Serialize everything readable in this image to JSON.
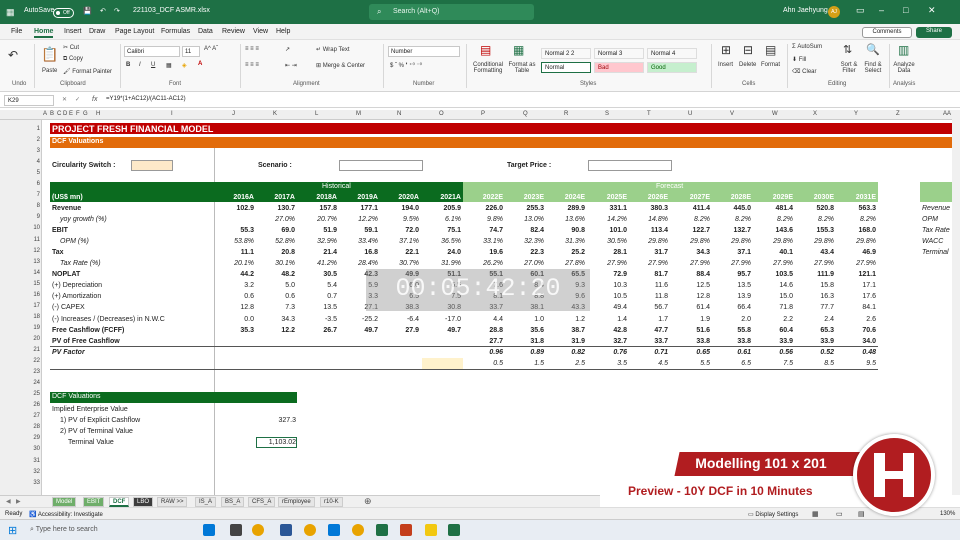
{
  "titlebar": {
    "autosave_label": "AutoSave",
    "autosave_state": "Off",
    "filename": "221103_DCF ASMR.xlsx",
    "search_placeholder": "Search (Alt+Q)",
    "user_name": "Ahn Jaehyung",
    "user_initials": "AJ"
  },
  "menu": {
    "items": [
      "File",
      "Home",
      "Insert",
      "Draw",
      "Page Layout",
      "Formulas",
      "Data",
      "Review",
      "View",
      "Help"
    ],
    "active": "Home",
    "comments_label": "Comments",
    "share_label": "Share"
  },
  "ribbon": {
    "undo": "Undo",
    "paste": "Paste",
    "cut": "Cut",
    "copy": "Copy",
    "format_painter": "Format Painter",
    "clipboard": "Clipboard",
    "font_name": "Calibri",
    "font_size": "11",
    "font_group": "Font",
    "wrap_text": "Wrap Text",
    "merge_center": "Merge & Center",
    "alignment_group": "Alignment",
    "number_format": "Number",
    "number_group": "Number",
    "conditional_formatting": "Conditional Formatting",
    "format_as_table": "Format as Table",
    "styles": [
      "Normal 2 2",
      "Normal 3",
      "Normal 4",
      "Normal",
      "Bad",
      "Good"
    ],
    "styles_group": "Styles",
    "insert": "Insert",
    "delete": "Delete",
    "format": "Format",
    "cells_group": "Cells",
    "autosum": "AutoSum",
    "fill": "Fill",
    "clear": "Clear",
    "sort_filter": "Sort & Filter",
    "find_select": "Find & Select",
    "editing_group": "Editing",
    "analyze_data": "Analyze Data",
    "analysis_group": "Analysis"
  },
  "formula_bar": {
    "name_box": "K29",
    "fx": "fx",
    "formula": "=Y19*(1+AC12)/(AC11-AC12)"
  },
  "columns": [
    "A",
    "B",
    "C",
    "D",
    "E",
    "F",
    "G",
    "H",
    "I",
    "J",
    "K",
    "L",
    "M",
    "N",
    "O",
    "P",
    "Q",
    "R",
    "S",
    "T",
    "U",
    "V",
    "W",
    "X",
    "Y",
    "Z",
    "AA"
  ],
  "rows": [
    "1",
    "2",
    "3",
    "4",
    "5",
    "6",
    "7",
    "8",
    "9",
    "10",
    "11",
    "12",
    "13",
    "14",
    "15",
    "16",
    "17",
    "18",
    "19",
    "20",
    "21",
    "22",
    "23",
    "24",
    "25",
    "26",
    "27",
    "28",
    "29",
    "30",
    "31",
    "32",
    "33"
  ],
  "sheet": {
    "title": "PROJECT FRESH FINANCIAL MODEL",
    "subtitle": "DCF Valuations",
    "circularity_label": "Circularity Switch :",
    "scenario_label": "Scenario :",
    "target_price_label": "Target Price :",
    "historical_label": "Historical",
    "forecast_label": "Forecast",
    "units_label": "(US$ mn)",
    "years": [
      "2016A",
      "2017A",
      "2018A",
      "2019A",
      "2020A",
      "2021A",
      "2022E",
      "2023E",
      "2024E",
      "2025E",
      "2026E",
      "2027E",
      "2028E",
      "2029E",
      "2030E",
      "2031E"
    ],
    "line_items": [
      {
        "label": "Revenue",
        "bold": true,
        "italic": false,
        "values": [
          "102.9",
          "130.7",
          "157.8",
          "177.1",
          "194.0",
          "205.9",
          "226.0",
          "255.3",
          "289.9",
          "331.1",
          "380.3",
          "411.4",
          "445.0",
          "481.4",
          "520.8",
          "563.3"
        ]
      },
      {
        "label": "yoy growth (%)",
        "bold": false,
        "italic": true,
        "indent": true,
        "values": [
          "",
          "27.0%",
          "20.7%",
          "12.2%",
          "9.5%",
          "6.1%",
          "9.8%",
          "13.0%",
          "13.6%",
          "14.2%",
          "14.8%",
          "8.2%",
          "8.2%",
          "8.2%",
          "8.2%",
          "8.2%"
        ]
      },
      {
        "label": "EBIT",
        "bold": true,
        "italic": false,
        "values": [
          "55.3",
          "69.0",
          "51.9",
          "59.1",
          "72.0",
          "75.1",
          "74.7",
          "82.4",
          "90.8",
          "101.0",
          "113.4",
          "122.7",
          "132.7",
          "143.6",
          "155.3",
          "168.0"
        ]
      },
      {
        "label": "OPM (%)",
        "bold": false,
        "italic": true,
        "indent": true,
        "values": [
          "53.8%",
          "52.8%",
          "32.9%",
          "33.4%",
          "37.1%",
          "36.5%",
          "33.1%",
          "32.3%",
          "31.3%",
          "30.5%",
          "29.8%",
          "29.8%",
          "29.8%",
          "29.8%",
          "29.8%",
          "29.8%"
        ]
      },
      {
        "label": "Tax",
        "bold": true,
        "italic": false,
        "values": [
          "11.1",
          "20.8",
          "21.4",
          "16.8",
          "22.1",
          "24.0",
          "19.6",
          "22.3",
          "25.2",
          "28.1",
          "31.7",
          "34.3",
          "37.1",
          "40.1",
          "43.4",
          "46.9"
        ]
      },
      {
        "label": "Tax Rate (%)",
        "bold": false,
        "italic": true,
        "indent": true,
        "values": [
          "20.1%",
          "30.1%",
          "41.2%",
          "28.4%",
          "30.7%",
          "31.9%",
          "26.2%",
          "27.0%",
          "27.8%",
          "27.9%",
          "27.9%",
          "27.9%",
          "27.9%",
          "27.9%",
          "27.9%",
          "27.9%"
        ]
      },
      {
        "label": "NOPLAT",
        "bold": true,
        "italic": false,
        "values": [
          "44.2",
          "48.2",
          "30.5",
          "42.3",
          "49.9",
          "51.1",
          "55.1",
          "60.1",
          "65.5",
          "72.9",
          "81.7",
          "88.4",
          "95.7",
          "103.5",
          "111.9",
          "121.1"
        ]
      },
      {
        "label": "(+) Depreciation",
        "bold": false,
        "italic": false,
        "values": [
          "3.2",
          "5.0",
          "5.4",
          "5.9",
          "6.0",
          "6.5",
          "7.6",
          "8.4",
          "9.3",
          "10.3",
          "11.6",
          "12.5",
          "13.5",
          "14.6",
          "15.8",
          "17.1"
        ]
      },
      {
        "label": "(+) Amortization",
        "bold": false,
        "italic": false,
        "values": [
          "0.6",
          "0.6",
          "0.7",
          "3.3",
          "6.5",
          "7.5",
          "8.1",
          "8.8",
          "9.6",
          "10.5",
          "11.8",
          "12.8",
          "13.9",
          "15.0",
          "16.3",
          "17.6"
        ]
      },
      {
        "label": "(-) CAPEX",
        "bold": false,
        "italic": false,
        "values": [
          "12.8",
          "7.3",
          "13.5",
          "27.1",
          "38.3",
          "30.8",
          "33.7",
          "38.1",
          "43.3",
          "49.4",
          "56.7",
          "61.4",
          "66.4",
          "71.8",
          "77.7",
          "84.1"
        ]
      },
      {
        "label": "(-) Increases / (Decreases) in N.W.C",
        "bold": false,
        "italic": false,
        "values": [
          "0.0",
          "34.3",
          "-3.5",
          "-25.2",
          "-6.4",
          "-17.0",
          "4.4",
          "1.0",
          "1.2",
          "1.4",
          "1.7",
          "1.9",
          "2.0",
          "2.2",
          "2.4",
          "2.6"
        ]
      },
      {
        "label": "Free Cashflow (FCFF)",
        "bold": true,
        "italic": false,
        "values": [
          "35.3",
          "12.2",
          "26.7",
          "49.7",
          "27.9",
          "49.7",
          "28.8",
          "35.6",
          "38.7",
          "42.8",
          "47.7",
          "51.6",
          "55.8",
          "60.4",
          "65.3",
          "70.6"
        ]
      },
      {
        "label": "PV of Free Cashflow",
        "bold": true,
        "italic": false,
        "values": [
          "",
          "",
          "",
          "",
          "",
          "",
          "27.7",
          "31.8",
          "31.9",
          "32.7",
          "33.7",
          "33.8",
          "33.8",
          "33.9",
          "33.9",
          "34.0"
        ]
      },
      {
        "label": "PV Factor",
        "bold": true,
        "italic": true,
        "values": [
          "",
          "",
          "",
          "",
          "",
          "",
          "0.96",
          "0.89",
          "0.82",
          "0.76",
          "0.71",
          "0.65",
          "0.61",
          "0.56",
          "0.52",
          "0.48"
        ]
      },
      {
        "label": "",
        "bold": false,
        "italic": true,
        "values": [
          "",
          "",
          "",
          "",
          "",
          "-0.5",
          "0.5",
          "1.5",
          "2.5",
          "3.5",
          "4.5",
          "5.5",
          "6.5",
          "7.5",
          "8.5",
          "9.5"
        ]
      }
    ],
    "right_labels": [
      "Revenue",
      "OPM",
      "Tax Rate",
      "WACC",
      "Terminal"
    ],
    "dcf_header": "DCF Valuations",
    "implied_ev_label": "Implied Enterprise Value",
    "pv_explicit_label": "1) PV of Explicit Cashflow",
    "pv_explicit_value": "327.3",
    "pv_terminal_label": "2) PV of Terminal Value",
    "terminal_value_label": "Terminal Value",
    "terminal_value": "1,103.02"
  },
  "sheet_tabs": [
    "Model",
    "EBIT",
    "DCF",
    "LBO",
    "RAW >>",
    "IS_A",
    "BS_A",
    "CFS_A",
    "rEmployee",
    "r10-K"
  ],
  "active_tab": "DCF",
  "status": {
    "ready": "Ready",
    "accessibility": "Accessibility: Investigate",
    "display_settings": "Display Settings",
    "zoom": "130%"
  },
  "taskbar": {
    "search_placeholder": "Type here to search"
  },
  "overlay": {
    "timer": "00:05:42:20",
    "title": "Modelling 101 x 201",
    "subtitle": "Preview - 10Y DCF in 10 Minutes"
  },
  "colors": {
    "excel_green": "#1e7045",
    "title_red": "#c00000",
    "subtitle_orange": "#e26b0a",
    "header_green": "#0b6b1f",
    "forecast_green": "#9bd08b",
    "overlay_red": "#b11d20"
  }
}
